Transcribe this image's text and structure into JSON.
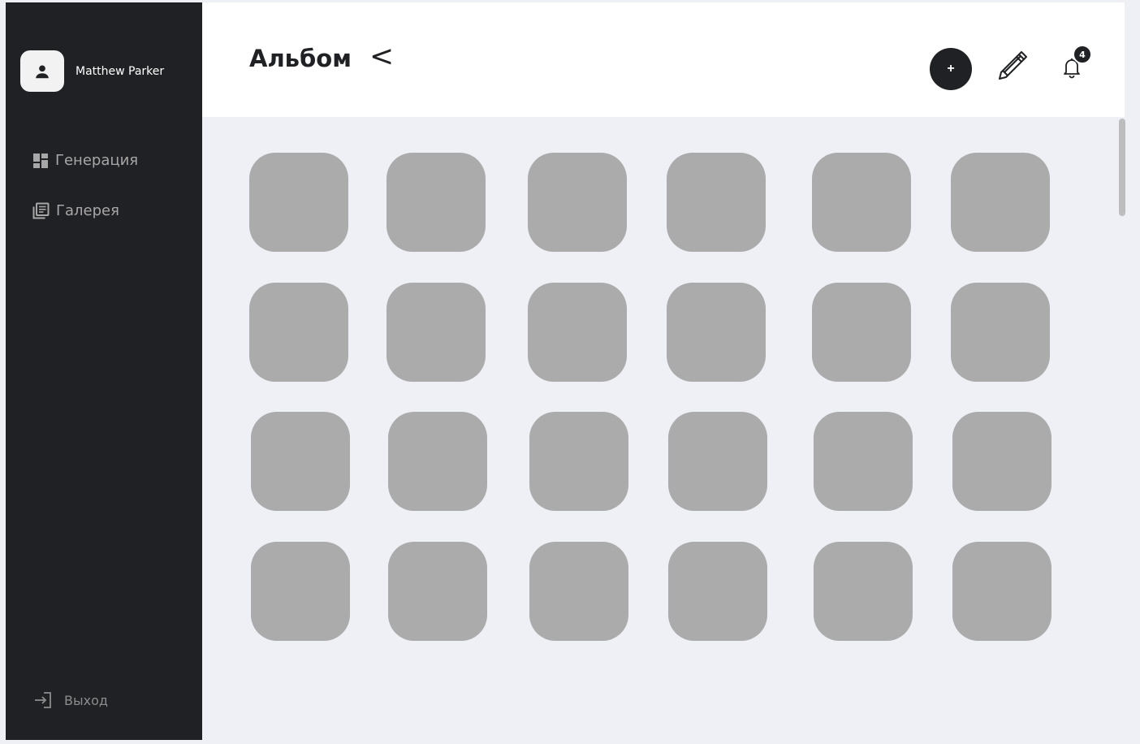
{
  "user": {
    "name": "Matthew Parker",
    "avatar_icon": "person-icon"
  },
  "sidebar": {
    "items": [
      {
        "label": "Генерация",
        "icon": "dashboard-icon"
      },
      {
        "label": "Галерея",
        "icon": "library-icon"
      }
    ],
    "logout_label": "Выход"
  },
  "header": {
    "title": "Альбом",
    "back_label": "<",
    "add_label": "+",
    "notifications_count": "4"
  },
  "gallery": {
    "rows": 4,
    "columns": 6,
    "tile_color": "#ababab"
  },
  "colors": {
    "sidebar": "#202124",
    "background": "#eef0f5",
    "header": "#ffffff",
    "accent": "#202124"
  }
}
